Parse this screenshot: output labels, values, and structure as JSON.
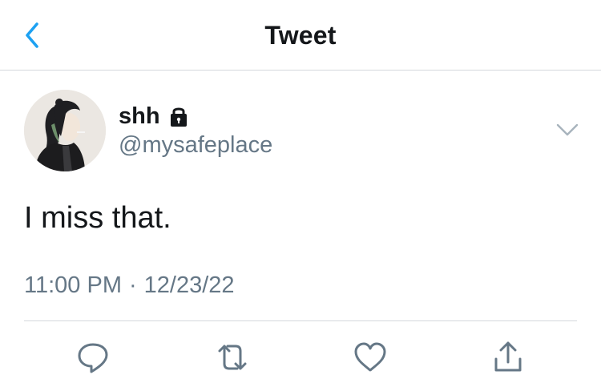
{
  "header": {
    "title": "Tweet",
    "back_icon": "chevron-left-icon",
    "accent_color": "#1da1f2"
  },
  "tweet": {
    "display_name": "shh",
    "protected_icon": "lock-icon",
    "handle": "@mysafeplace",
    "text": "I miss that.",
    "time": "11:00 PM",
    "separator": "·",
    "date": "12/23/22",
    "menu_icon": "chevron-down-icon"
  },
  "actions": [
    {
      "name": "reply",
      "icon": "reply-icon"
    },
    {
      "name": "retweet",
      "icon": "retweet-icon"
    },
    {
      "name": "like",
      "icon": "heart-icon"
    },
    {
      "name": "share",
      "icon": "share-icon"
    }
  ],
  "colors": {
    "text_primary": "#14171a",
    "text_secondary": "#657786",
    "divider": "#d4d8dc",
    "icon_gray": "#657786"
  }
}
